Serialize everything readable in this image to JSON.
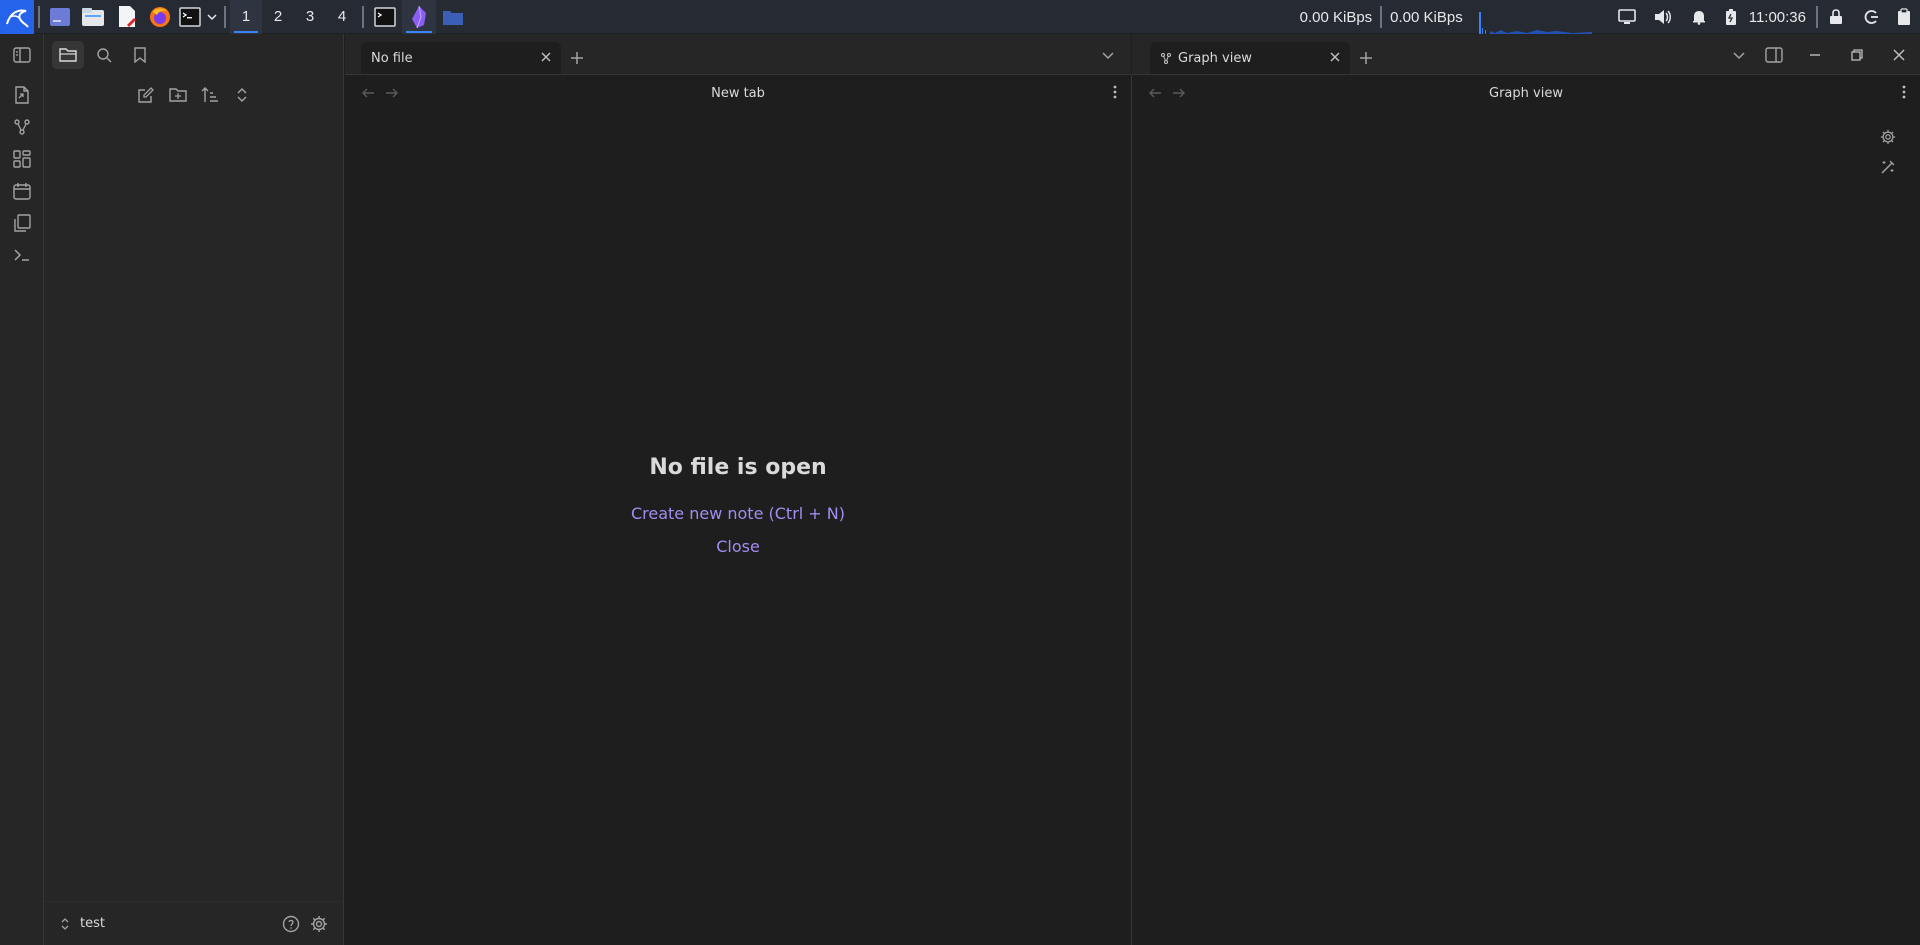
{
  "taskbar": {
    "workspaces": [
      "1",
      "2",
      "3",
      "4"
    ],
    "active_workspace": "1",
    "net_down": "0.00 KiBps",
    "net_up": "0.00 KiBps",
    "clock": "11:00:36",
    "accent": "#3b82f6"
  },
  "ribbon": {
    "items": [
      "open-quick-switcher-icon",
      "graph-view-icon",
      "canvas-icon",
      "daily-notes-icon",
      "templates-icon",
      "command-palette-icon"
    ]
  },
  "sidebar": {
    "tabs": [
      "files-icon",
      "search-icon",
      "bookmarks-icon"
    ],
    "actions": [
      "new-note-icon",
      "new-folder-icon",
      "sort-icon",
      "collapse-icon"
    ],
    "vault_name": "test"
  },
  "left_pane": {
    "tab_label": "No file",
    "header_title": "New tab",
    "empty_title": "No file is open",
    "create_link": "Create new note (Ctrl + N)",
    "close_link": "Close",
    "link_color": "#a38cf0"
  },
  "right_pane": {
    "tab_label": "Graph view",
    "header_title": "Graph view"
  }
}
